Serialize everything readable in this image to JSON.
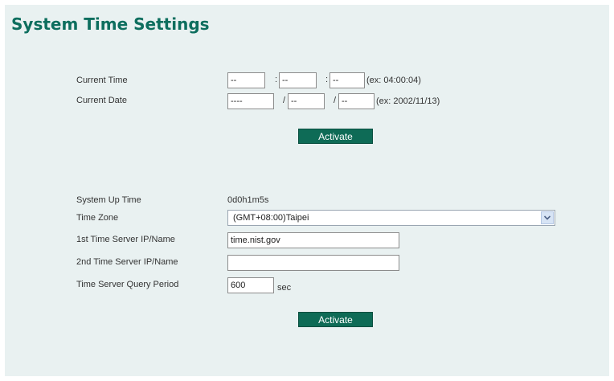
{
  "title": "System Time Settings",
  "time": {
    "current_time_label": "Current Time",
    "hour": "--",
    "minute": "--",
    "second": "--",
    "time_sep_1": ":",
    "time_sep_2": ":",
    "time_example": "(ex: 04:00:04)",
    "current_date_label": "Current Date",
    "year": "----",
    "month": "--",
    "day": "--",
    "date_sep_1": "/",
    "date_sep_2": "/",
    "date_example": "(ex: 2002/11/13)",
    "activate_label": "Activate"
  },
  "settings": {
    "uptime_label": "System Up Time",
    "uptime_value": "0d0h1m5s",
    "timezone_label": "Time Zone",
    "timezone_value": "(GMT+08:00)Taipei",
    "server1_label": "1st Time Server IP/Name",
    "server1_value": "time.nist.gov",
    "server2_label": "2nd Time Server IP/Name",
    "server2_value": "",
    "query_period_label": "Time Server Query Period",
    "query_period_value": "600",
    "query_period_unit": "sec",
    "activate_label": "Activate"
  },
  "colors": {
    "title": "#0d6e5e",
    "button_bg": "#0e6b56",
    "panel_bg": "#e9f1f1"
  }
}
